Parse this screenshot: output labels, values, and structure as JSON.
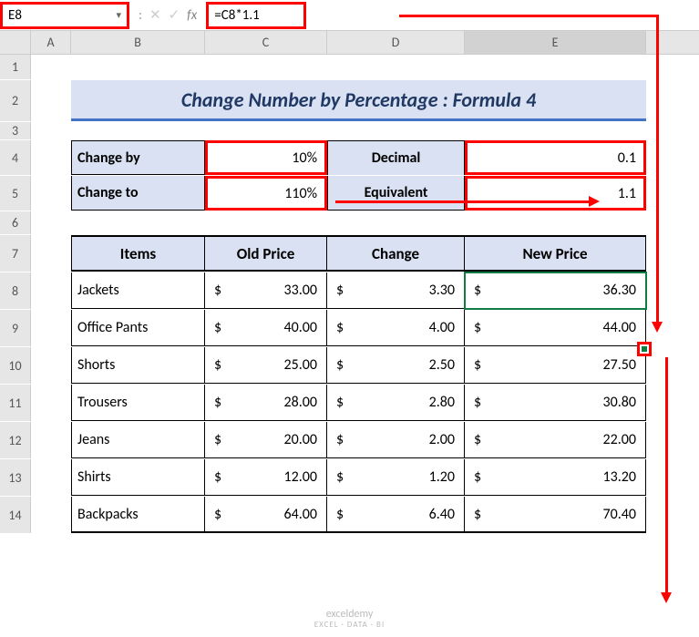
{
  "name_box": "E8",
  "formula": "=C8*1.1",
  "columns": [
    "A",
    "B",
    "C",
    "D",
    "E"
  ],
  "row_numbers": [
    "1",
    "2",
    "3",
    "4",
    "5",
    "6",
    "7",
    "8",
    "9",
    "10",
    "11",
    "12",
    "13",
    "14"
  ],
  "title": "Change Number by Percentage : Formula 4",
  "change_by_label": "Change by",
  "change_by_pct": "10%",
  "change_to_label": "Change to",
  "change_to_pct": "110%",
  "decimal_label_1": "Decimal",
  "decimal_label_2": "Equivalent",
  "decimal_val_1": "0.1",
  "decimal_val_2": "1.1",
  "headers": {
    "items": "Items",
    "old": "Old Price",
    "change": "Change",
    "new": "New Price"
  },
  "rows": [
    {
      "item": "Jackets",
      "old": "33.00",
      "change": "3.30",
      "new": "36.30"
    },
    {
      "item": "Office Pants",
      "old": "40.00",
      "change": "4.00",
      "new": "44.00"
    },
    {
      "item": "Shorts",
      "old": "25.00",
      "change": "2.50",
      "new": "27.50"
    },
    {
      "item": "Trousers",
      "old": "28.00",
      "change": "2.80",
      "new": "30.80"
    },
    {
      "item": "Jeans",
      "old": "20.00",
      "change": "2.00",
      "new": "22.00"
    },
    {
      "item": "Shirts",
      "old": "12.00",
      "change": "1.20",
      "new": "13.20"
    },
    {
      "item": "Backpacks",
      "old": "64.00",
      "change": "6.40",
      "new": "70.40"
    }
  ],
  "currency_symbol": "$",
  "watermark_top": "exceldemy",
  "watermark_bottom": "EXCEL · DATA · BI",
  "chart_data": {
    "type": "table",
    "title": "Change Number by Percentage : Formula 4",
    "parameters": {
      "change_by_percent": 10,
      "change_to_percent": 110,
      "decimal_change_by": 0.1,
      "decimal_change_to": 1.1
    },
    "columns": [
      "Items",
      "Old Price",
      "Change",
      "New Price"
    ],
    "data": [
      [
        "Jackets",
        33.0,
        3.3,
        36.3
      ],
      [
        "Office Pants",
        40.0,
        4.0,
        44.0
      ],
      [
        "Shorts",
        25.0,
        2.5,
        27.5
      ],
      [
        "Trousers",
        28.0,
        2.8,
        30.8
      ],
      [
        "Jeans",
        20.0,
        2.0,
        22.0
      ],
      [
        "Shirts",
        12.0,
        1.2,
        13.2
      ],
      [
        "Backpacks",
        64.0,
        6.4,
        70.4
      ]
    ],
    "formula_example": "=C8*1.1"
  }
}
